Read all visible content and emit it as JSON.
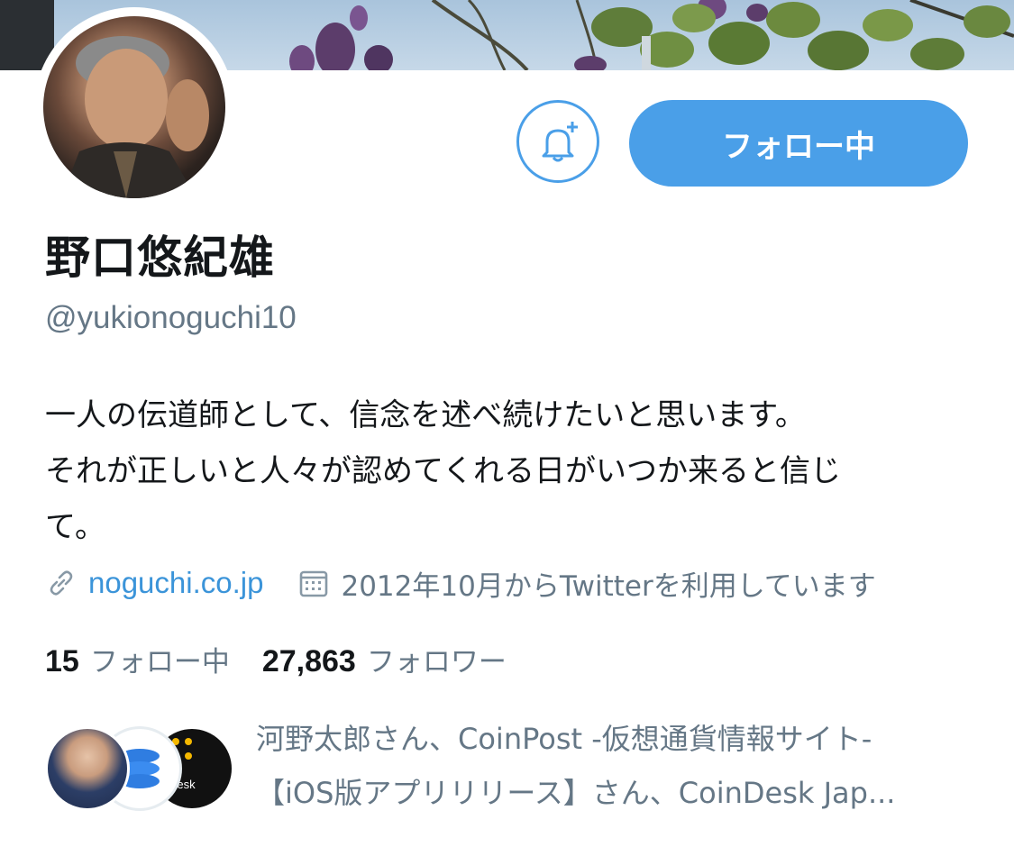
{
  "profile": {
    "name": "野口悠紀雄",
    "handle": "@yukionoguchi10",
    "bio_lines": [
      "一人の伝道師として、信念を述べ続けたいと思います。",
      "それが正しいと人々が認めてくれる日がいつか来ると信じ",
      "て。"
    ],
    "website": "noguchi.co.jp",
    "joined": "2012年10月からTwitterを利用しています"
  },
  "actions": {
    "follow_label": "フォロー中",
    "notify_icon": "bell-plus-icon"
  },
  "stats": {
    "following_count": "15",
    "following_label": "フォロー中",
    "followers_count": "27,863",
    "followers_label": "フォロワー"
  },
  "followers_you_know": {
    "line1": "河野太郎さん、CoinPost -仮想通貨情報サイト-",
    "line2": "【iOS版アプリリリース】さん、CoinDesk Jap...",
    "badge_text": "indesk"
  },
  "colors": {
    "accent": "#4a9fe8",
    "link": "#3b94d9",
    "secondary_text": "#657786",
    "primary_text": "#14171a"
  }
}
